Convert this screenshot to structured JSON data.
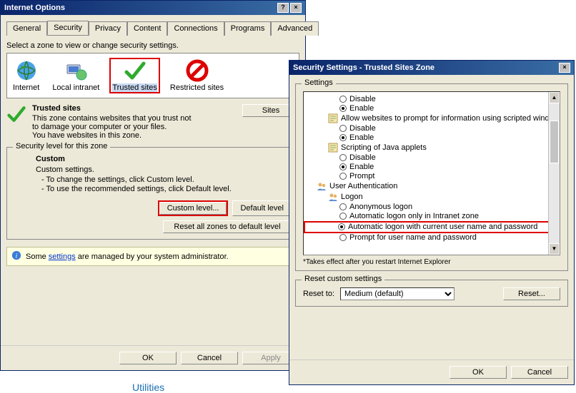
{
  "internet_options": {
    "title": "Internet Options",
    "tabs": [
      "General",
      "Security",
      "Privacy",
      "Content",
      "Connections",
      "Programs",
      "Advanced"
    ],
    "active_tab": "Security",
    "zone_prompt": "Select a zone to view or change security settings.",
    "zones": [
      {
        "label": "Internet"
      },
      {
        "label": "Local intranet"
      },
      {
        "label": "Trusted sites"
      },
      {
        "label": "Restricted sites"
      }
    ],
    "selected_zone_index": 2,
    "trusted": {
      "heading": "Trusted sites",
      "line1": "This zone contains websites that you trust not to damage your computer or your files.",
      "line2": "You have websites in this zone."
    },
    "sites_btn": "Sites",
    "level_group": "Security level for this zone",
    "level": {
      "title": "Custom",
      "sub": "Custom settings.",
      "line_a": "- To change the settings, click Custom level.",
      "line_b": "- To use the recommended settings, click Default level."
    },
    "custom_btn": "Custom level...",
    "default_btn": "Default level",
    "reset_all_btn": "Reset all zones to default level",
    "info_pre": "Some ",
    "info_link": "settings",
    "info_post": " are managed by your system administrator.",
    "ok": "OK",
    "cancel": "Cancel",
    "apply": "Apply"
  },
  "security_settings": {
    "title": "Security Settings - Trusted Sites Zone",
    "settings_group": "Settings",
    "tree": {
      "first_pair": {
        "disable": "Disable",
        "enable": "Enable",
        "selected": "enable"
      },
      "allow_prompt": "Allow websites to prompt for information using scripted windo",
      "allow_pair": {
        "disable": "Disable",
        "enable": "Enable",
        "selected": "enable"
      },
      "java_scripting": "Scripting of Java applets",
      "java_opts": {
        "disable": "Disable",
        "enable": "Enable",
        "prompt": "Prompt",
        "selected": "enable"
      },
      "user_auth": "User Authentication",
      "logon": "Logon",
      "logon_opts": [
        {
          "label": "Anonymous logon",
          "selected": false
        },
        {
          "label": "Automatic logon only in Intranet zone",
          "selected": false
        },
        {
          "label": "Automatic logon with current user name and password",
          "selected": true,
          "highlight": true
        },
        {
          "label": "Prompt for user name and password",
          "selected": false
        }
      ]
    },
    "footnote": "*Takes effect after you restart Internet Explorer",
    "reset_group": "Reset custom settings",
    "reset_label": "Reset to:",
    "reset_value": "Medium (default)",
    "reset_btn": "Reset...",
    "ok": "OK",
    "cancel": "Cancel"
  },
  "stray_text": "Utilities"
}
